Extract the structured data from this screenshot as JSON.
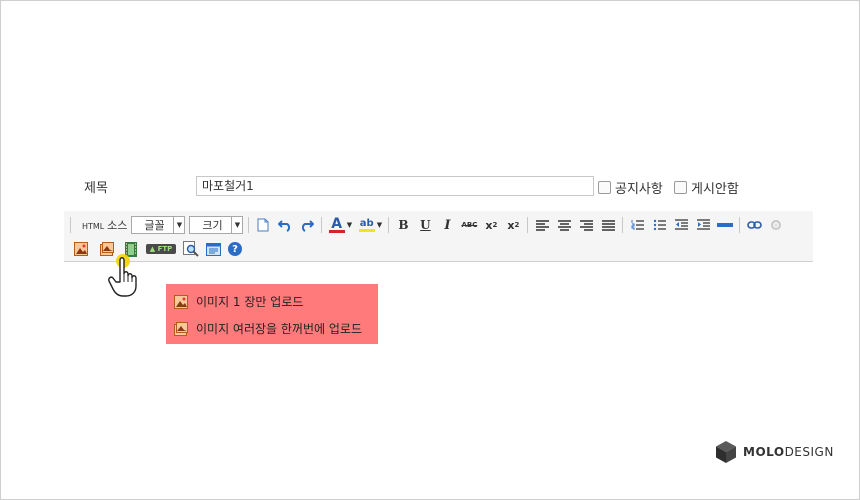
{
  "form": {
    "title_label": "제목",
    "title_value": "마포철거1",
    "checkbox_notice": "공지사항",
    "checkbox_hide": "게시안함"
  },
  "toolbar": {
    "html_prefix": "HTML",
    "html_label": "소스",
    "font_select": "글꼴",
    "size_select": "크기",
    "bold": "B",
    "underline": "U",
    "italic": "I",
    "strike": "ABC",
    "superscript": "x",
    "subscript": "x",
    "superscript_mark": "2",
    "subscript_mark": "2",
    "ftp_label": "FTP",
    "help": "?",
    "text_color_letter": "A",
    "highlight_letters": "ab"
  },
  "image_menu": {
    "single_upload": "이미지 1 장만 업로드",
    "multi_upload": "이미지 여러장을 한꺼번에 업로드"
  },
  "logo": {
    "brand_bold": "MOLO",
    "brand_light": "DESIGN"
  },
  "colors": {
    "highlight": "#ff7b7b",
    "accent_blue": "#2b6cc4",
    "font_color_bar": "#d9202a",
    "highlight_bar": "#f2e31a"
  }
}
